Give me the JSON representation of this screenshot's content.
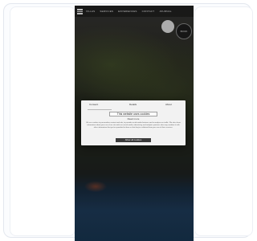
{
  "app": {
    "nav_items": [
      "VILLAS",
      "SERVICES",
      "EXPERIENCES",
      "CONTACT",
      "JOURNAL"
    ],
    "badge_dark_text": "BOOK"
  },
  "cookie_modal": {
    "tabs": [
      "Consent",
      "Details",
      "About"
    ],
    "heading": "This website uses cookies",
    "subheading": "Read more",
    "body": "We use cookies to personalise content and ads, to provide social media features and to analyse our traffic. We also share information about your use of our site with our social media, advertising and analytics partners who may combine it with other information that you've provided to them or that they've collected from your use of their services.",
    "button_label": "Allow all cookies"
  }
}
